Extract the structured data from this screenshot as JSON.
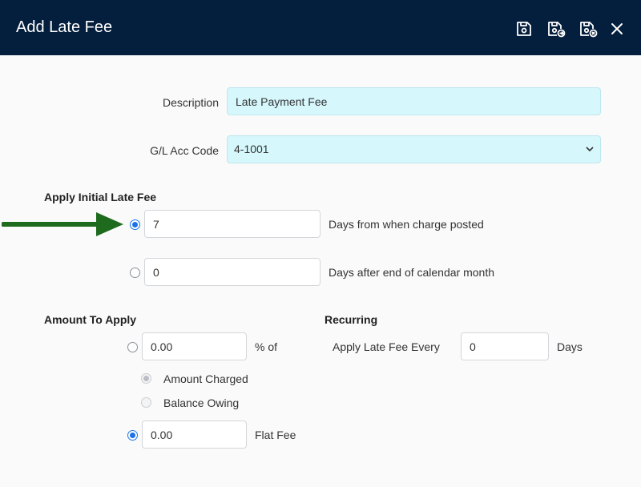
{
  "header": {
    "title": "Add Late Fee",
    "icons": [
      "save-icon",
      "save-and-new-icon",
      "save-and-close-icon",
      "close-icon"
    ]
  },
  "form": {
    "description": {
      "label": "Description",
      "value": "Late Payment Fee"
    },
    "gl_acc_code": {
      "label": "G/L Acc Code",
      "value": "4-1001"
    },
    "apply_initial_late_fee": {
      "heading": "Apply Initial Late Fee",
      "options": [
        {
          "value": "7",
          "suffix": "Days from when charge posted",
          "selected": true
        },
        {
          "value": "0",
          "suffix": "Days after end of calendar month",
          "selected": false
        }
      ]
    },
    "amount_to_apply": {
      "heading": "Amount To Apply",
      "percent": {
        "value": "0.00",
        "suffix": "% of",
        "selected": false
      },
      "percent_basis": [
        {
          "label": "Amount Charged",
          "selected": true,
          "disabled": true
        },
        {
          "label": "Balance Owing",
          "selected": false,
          "disabled": true
        }
      ],
      "flat": {
        "value": "0.00",
        "suffix": "Flat Fee",
        "selected": true
      }
    },
    "recurring": {
      "heading": "Recurring",
      "label": "Apply Late Fee Every",
      "value": "0",
      "suffix": "Days"
    }
  },
  "colors": {
    "header_bg": "#041e3d",
    "field_highlight": "#d6f7fc",
    "radio_accent": "#1a73e8",
    "arrow": "#1e6b1e"
  }
}
